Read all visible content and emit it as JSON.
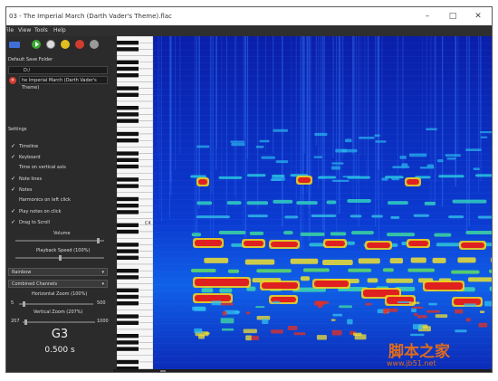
{
  "window": {
    "title": "03 - The Imperial March (Darth Vader's Theme).flac",
    "minimize": "–",
    "maximize": "□",
    "close": "✕"
  },
  "menu": [
    "File",
    "View",
    "Tools",
    "Help"
  ],
  "toolbar": {
    "icons": [
      "folder-icon",
      "play-icon",
      "settings-icon",
      "info-icon",
      "clock-icon"
    ],
    "colors": [
      "#3f6fd8",
      "#3aa832",
      "#dcdcdc",
      "#e0c020",
      "#d23b2f",
      "#9a9a9a"
    ]
  },
  "save_folder": {
    "label": "Default Save Folder",
    "value": "D:/"
  },
  "track": {
    "value": "he Imperial March (Darth Vader's Theme)"
  },
  "settings": {
    "label": "Settings",
    "options": [
      {
        "label": "Timeline",
        "checked": true
      },
      {
        "label": "Keyboard",
        "checked": true
      },
      {
        "label": "Time on vertical axis",
        "checked": false
      },
      {
        "label": "Note lines",
        "checked": true
      },
      {
        "label": "Notes",
        "checked": true
      },
      {
        "label": "Harmonics on left click",
        "checked": false
      },
      {
        "label": "Play notes on click",
        "checked": true
      },
      {
        "label": "Drag to Scroll",
        "checked": true
      }
    ],
    "checkmark": "✓",
    "volume_label": "Volume",
    "volume_level": 0.95,
    "speed_label": "Playback Speed (100%)",
    "speed_level": 0.5,
    "colormap": "Rainbow",
    "channels": "Combined Channels",
    "dropdown_arrow": "▾",
    "hzoom_label": "Horizontal Zoom (100%)",
    "hzoom_min": "5",
    "hzoom_max": "500",
    "vzoom_label": "Vertical Zoom (207%)",
    "vzoom_min": "207",
    "vzoom_max": "1000"
  },
  "readout": {
    "note": "G3",
    "time": "0.500 s"
  },
  "piano": {
    "c_label": "C4"
  },
  "watermark": {
    "text": "脚本之家",
    "url": "www.jb51.net"
  }
}
